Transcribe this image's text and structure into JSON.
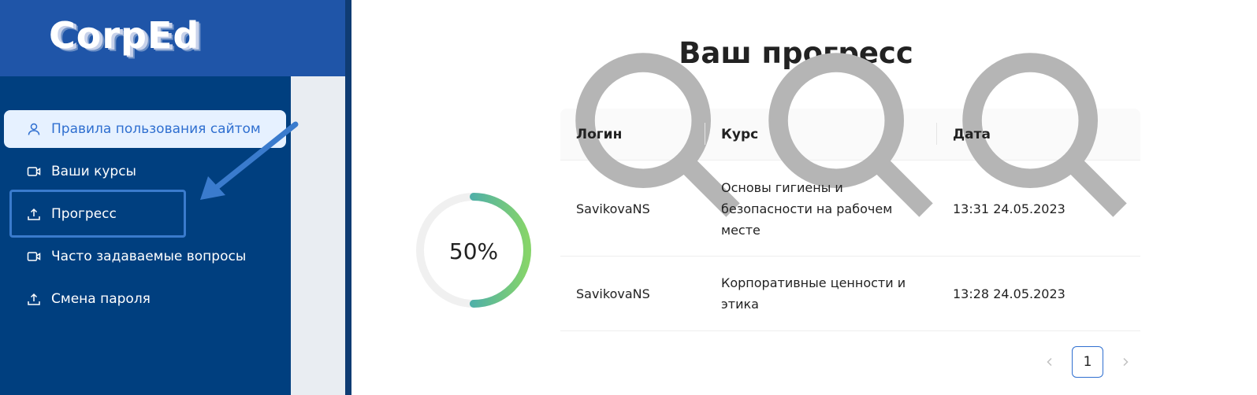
{
  "app": {
    "logo": "CorpEd"
  },
  "sidebar": {
    "items": [
      {
        "label": "Правила пользования сайтом",
        "icon": "user-icon",
        "active": true
      },
      {
        "label": "Ваши курсы",
        "icon": "video-icon"
      },
      {
        "label": "Прогресс",
        "icon": "upload-icon"
      },
      {
        "label": "Часто задаваемые вопросы",
        "icon": "video-icon"
      },
      {
        "label": "Смена пароля",
        "icon": "upload-icon"
      }
    ]
  },
  "main": {
    "title": "Ваш прогресс",
    "progress": {
      "percent_label": "50%",
      "value": 0.5
    },
    "table": {
      "columns": [
        "Логин",
        "Курс",
        "Дата"
      ],
      "rows": [
        {
          "login": "SavikovaNS",
          "course_lines": [
            "Основы гигиены и",
            "безопасности на рабочем",
            "месте"
          ],
          "date": "13:31 24.05.2023"
        },
        {
          "login": "SavikovaNS",
          "course_lines": [
            "Корпоративные ценности и",
            "этика"
          ],
          "date": "13:28 24.05.2023"
        }
      ]
    },
    "pagination": {
      "current": "1",
      "prev_icon": "chevron-left-icon",
      "next_icon": "chevron-right-icon"
    }
  },
  "colors": {
    "sidebar_bg": "#003f7f",
    "logo_bar_bg": "#1f55a8",
    "active_bg": "#e6f1ff",
    "accent": "#2f6fd0",
    "progress_start": "#1e8fe0",
    "progress_end": "#86d46a"
  }
}
